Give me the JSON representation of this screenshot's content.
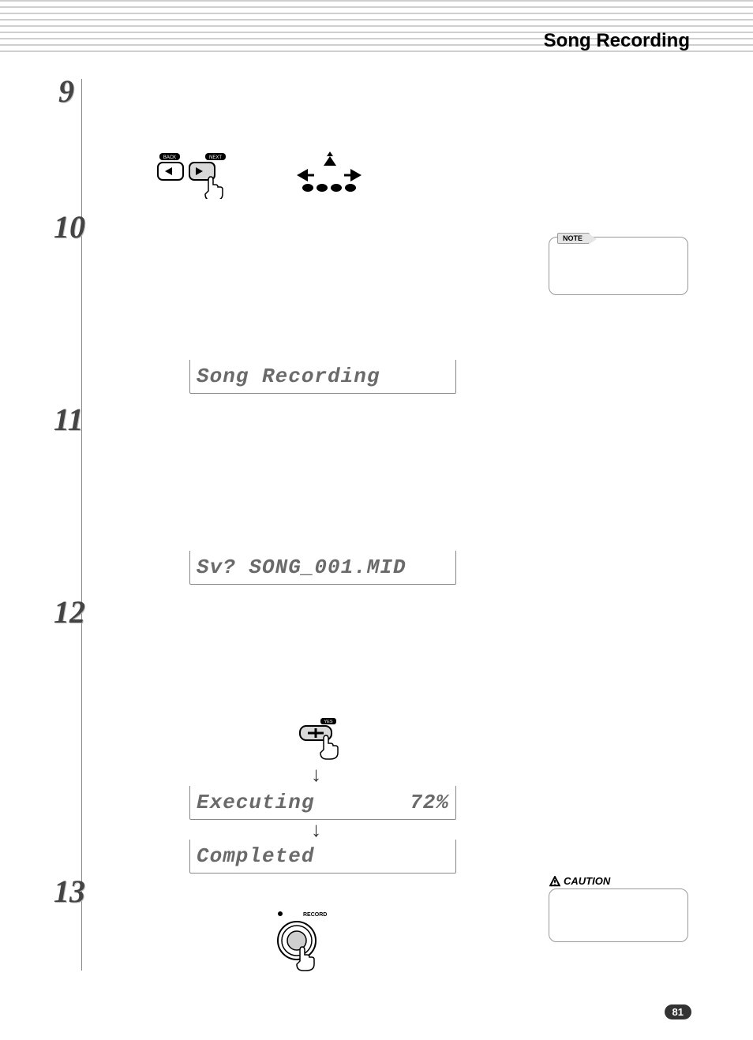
{
  "header": {
    "title": "Song Recording"
  },
  "steps": {
    "s9": "9",
    "s10": "10",
    "s11": "11",
    "s12": "12",
    "s13": "13"
  },
  "lcd": {
    "line1": "Song Recording",
    "line2": "Sv? SONG_001.MID",
    "line3_left": "Executing",
    "line3_right": "72%",
    "line4": "Completed"
  },
  "note": {
    "tab": "NOTE"
  },
  "caution": {
    "label": "CAUTION"
  },
  "icons": {
    "back_label": "BACK",
    "next_label": "NEXT",
    "yes_label": "YES",
    "record_label": "RECORD",
    "arrow_down": "↓"
  },
  "page": {
    "number": "81"
  }
}
